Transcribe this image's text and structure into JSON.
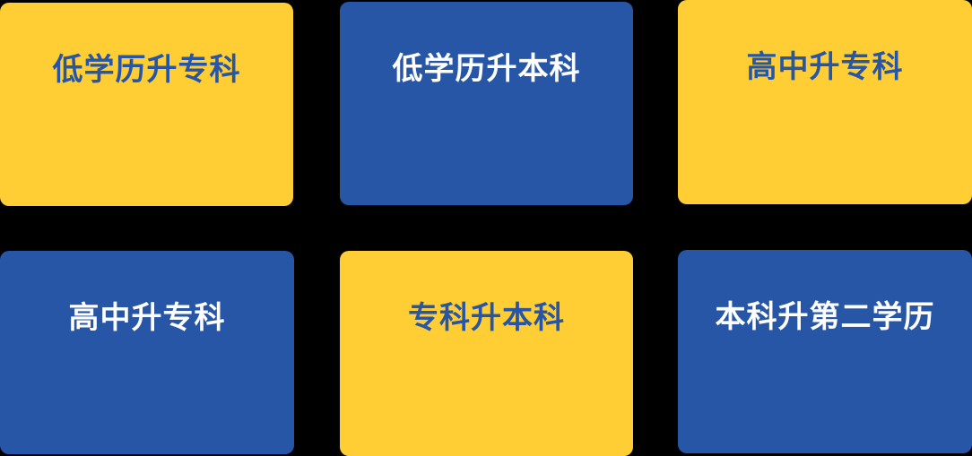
{
  "colors": {
    "background": "#000000",
    "yellow": "#FFCE34",
    "blue": "#2756A6",
    "white": "#FFFFFF"
  },
  "cards": [
    {
      "label": "低学历升专科",
      "style": "yellow"
    },
    {
      "label": "低学历升本科",
      "style": "blue"
    },
    {
      "label": "高中升专科",
      "style": "yellow"
    },
    {
      "label": "高中升专科",
      "style": "blue"
    },
    {
      "label": "专科升本科",
      "style": "yellow"
    },
    {
      "label": "本科升第二学历",
      "style": "blue"
    }
  ]
}
